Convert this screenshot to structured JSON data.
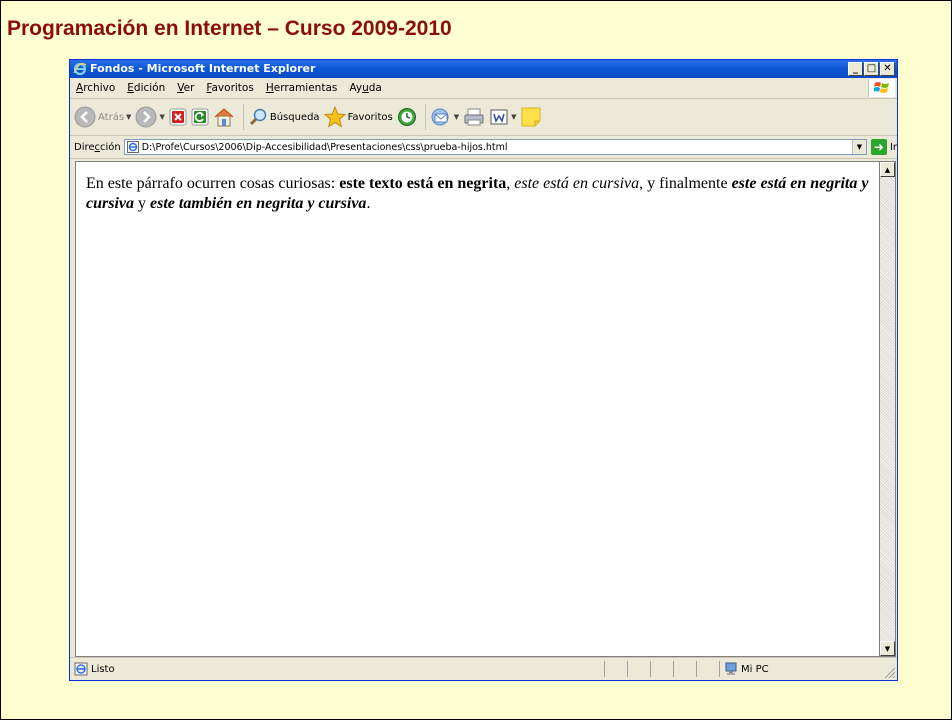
{
  "slide": {
    "title": "Programación en Internet – Curso 2009-2010"
  },
  "window": {
    "title": "Fondos - Microsoft Internet Explorer",
    "buttons": {
      "minimize": "_",
      "maximize": "□",
      "close": "✕"
    }
  },
  "menubar": {
    "items": [
      {
        "label": "Archivo",
        "accel": "A",
        "rest": "rchivo"
      },
      {
        "label": "Edición",
        "accel": "E",
        "rest": "dición"
      },
      {
        "label": "Ver",
        "accel": "V",
        "rest": "er"
      },
      {
        "label": "Favoritos",
        "accel": "F",
        "rest": "avoritos"
      },
      {
        "label": "Herramientas",
        "accel": "H",
        "rest": "erramientas"
      },
      {
        "label": "Ayuda",
        "pre": "Ay",
        "accel": "u",
        "rest": "da"
      }
    ]
  },
  "toolbar": {
    "back_label": "Atrás",
    "search_label": "Búsqueda",
    "favorites_label": "Favoritos"
  },
  "address": {
    "label": "Dirección",
    "url": "D:\\Profe\\Cursos\\2006\\Dip-Accesibilidad\\Presentaciones\\css\\prueba-hijos.html",
    "go_label": "Ir"
  },
  "content": {
    "seg1": "En este párrafo ocurren cosas curiosas: ",
    "seg2_bold": "este texto está en negrita",
    "seg3": ", ",
    "seg4_italic": "este está en cursiva",
    "seg5": ", y finalmente ",
    "seg6_bold_italic": "este está en negrita y cursiva",
    "seg7": " y ",
    "seg8_bold_italic": "este también en negrita y cursiva",
    "seg9": "."
  },
  "status": {
    "text": "Listo",
    "zone": "Mi PC"
  },
  "colors": {
    "slide_background": "#fefed0",
    "title_color": "#8b0d0d",
    "titlebar_blue": "#0b56d6"
  }
}
